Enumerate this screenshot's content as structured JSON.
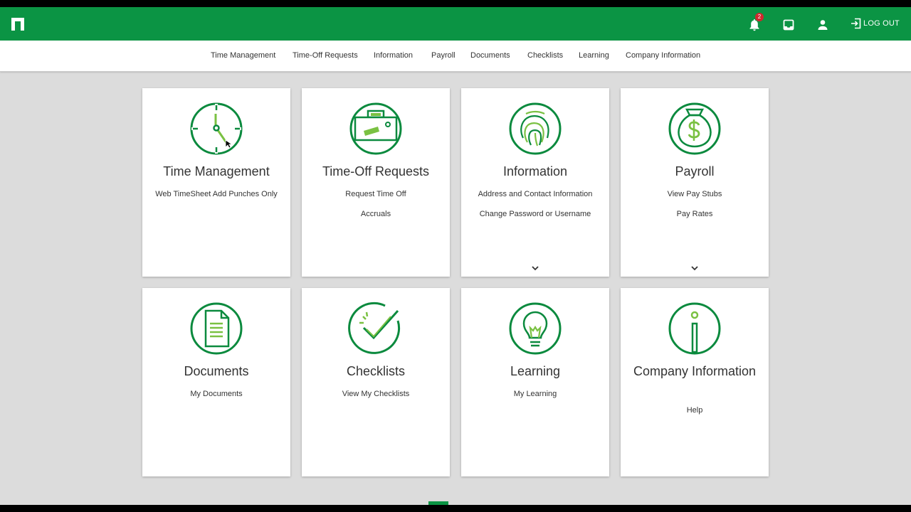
{
  "header": {
    "logo_icon": "paycom-logo-icon",
    "notifications_icon": "bell-icon",
    "notification_count": "2",
    "inbox_icon": "inbox-icon",
    "profile_icon": "person-icon",
    "logout_icon": "logout-icon",
    "logout_label": "LOG OUT",
    "accent_color": "#0b9444"
  },
  "nav": {
    "items": [
      "Time Management",
      "Time-Off Requests",
      "Information",
      "Payroll",
      "Documents",
      "Checklists",
      "Learning",
      "Company Information"
    ]
  },
  "cards": [
    {
      "title": "Time Management",
      "icon": "clock-icon",
      "links": [
        "Web TimeSheet Add Punches Only"
      ],
      "has_more": false
    },
    {
      "title": "Time-Off Requests",
      "icon": "suitcase-icon",
      "links": [
        "Request Time Off",
        "Accruals"
      ],
      "has_more": false
    },
    {
      "title": "Information",
      "icon": "fingerprint-icon",
      "links": [
        "Address and Contact Information",
        "Change Password or Username"
      ],
      "has_more": true
    },
    {
      "title": "Payroll",
      "icon": "money-bag-icon",
      "links": [
        "View Pay Stubs",
        "Pay Rates"
      ],
      "has_more": true
    },
    {
      "title": "Documents",
      "icon": "document-icon",
      "links": [
        "My Documents"
      ],
      "has_more": false
    },
    {
      "title": "Checklists",
      "icon": "checkmark-icon",
      "links": [
        "View My Checklists"
      ],
      "has_more": false
    },
    {
      "title": "Learning",
      "icon": "lightbulb-icon",
      "links": [
        "My Learning"
      ],
      "has_more": false
    },
    {
      "title": "Company Information",
      "icon": "info-icon",
      "links": [
        "Help"
      ],
      "has_more": false
    }
  ]
}
